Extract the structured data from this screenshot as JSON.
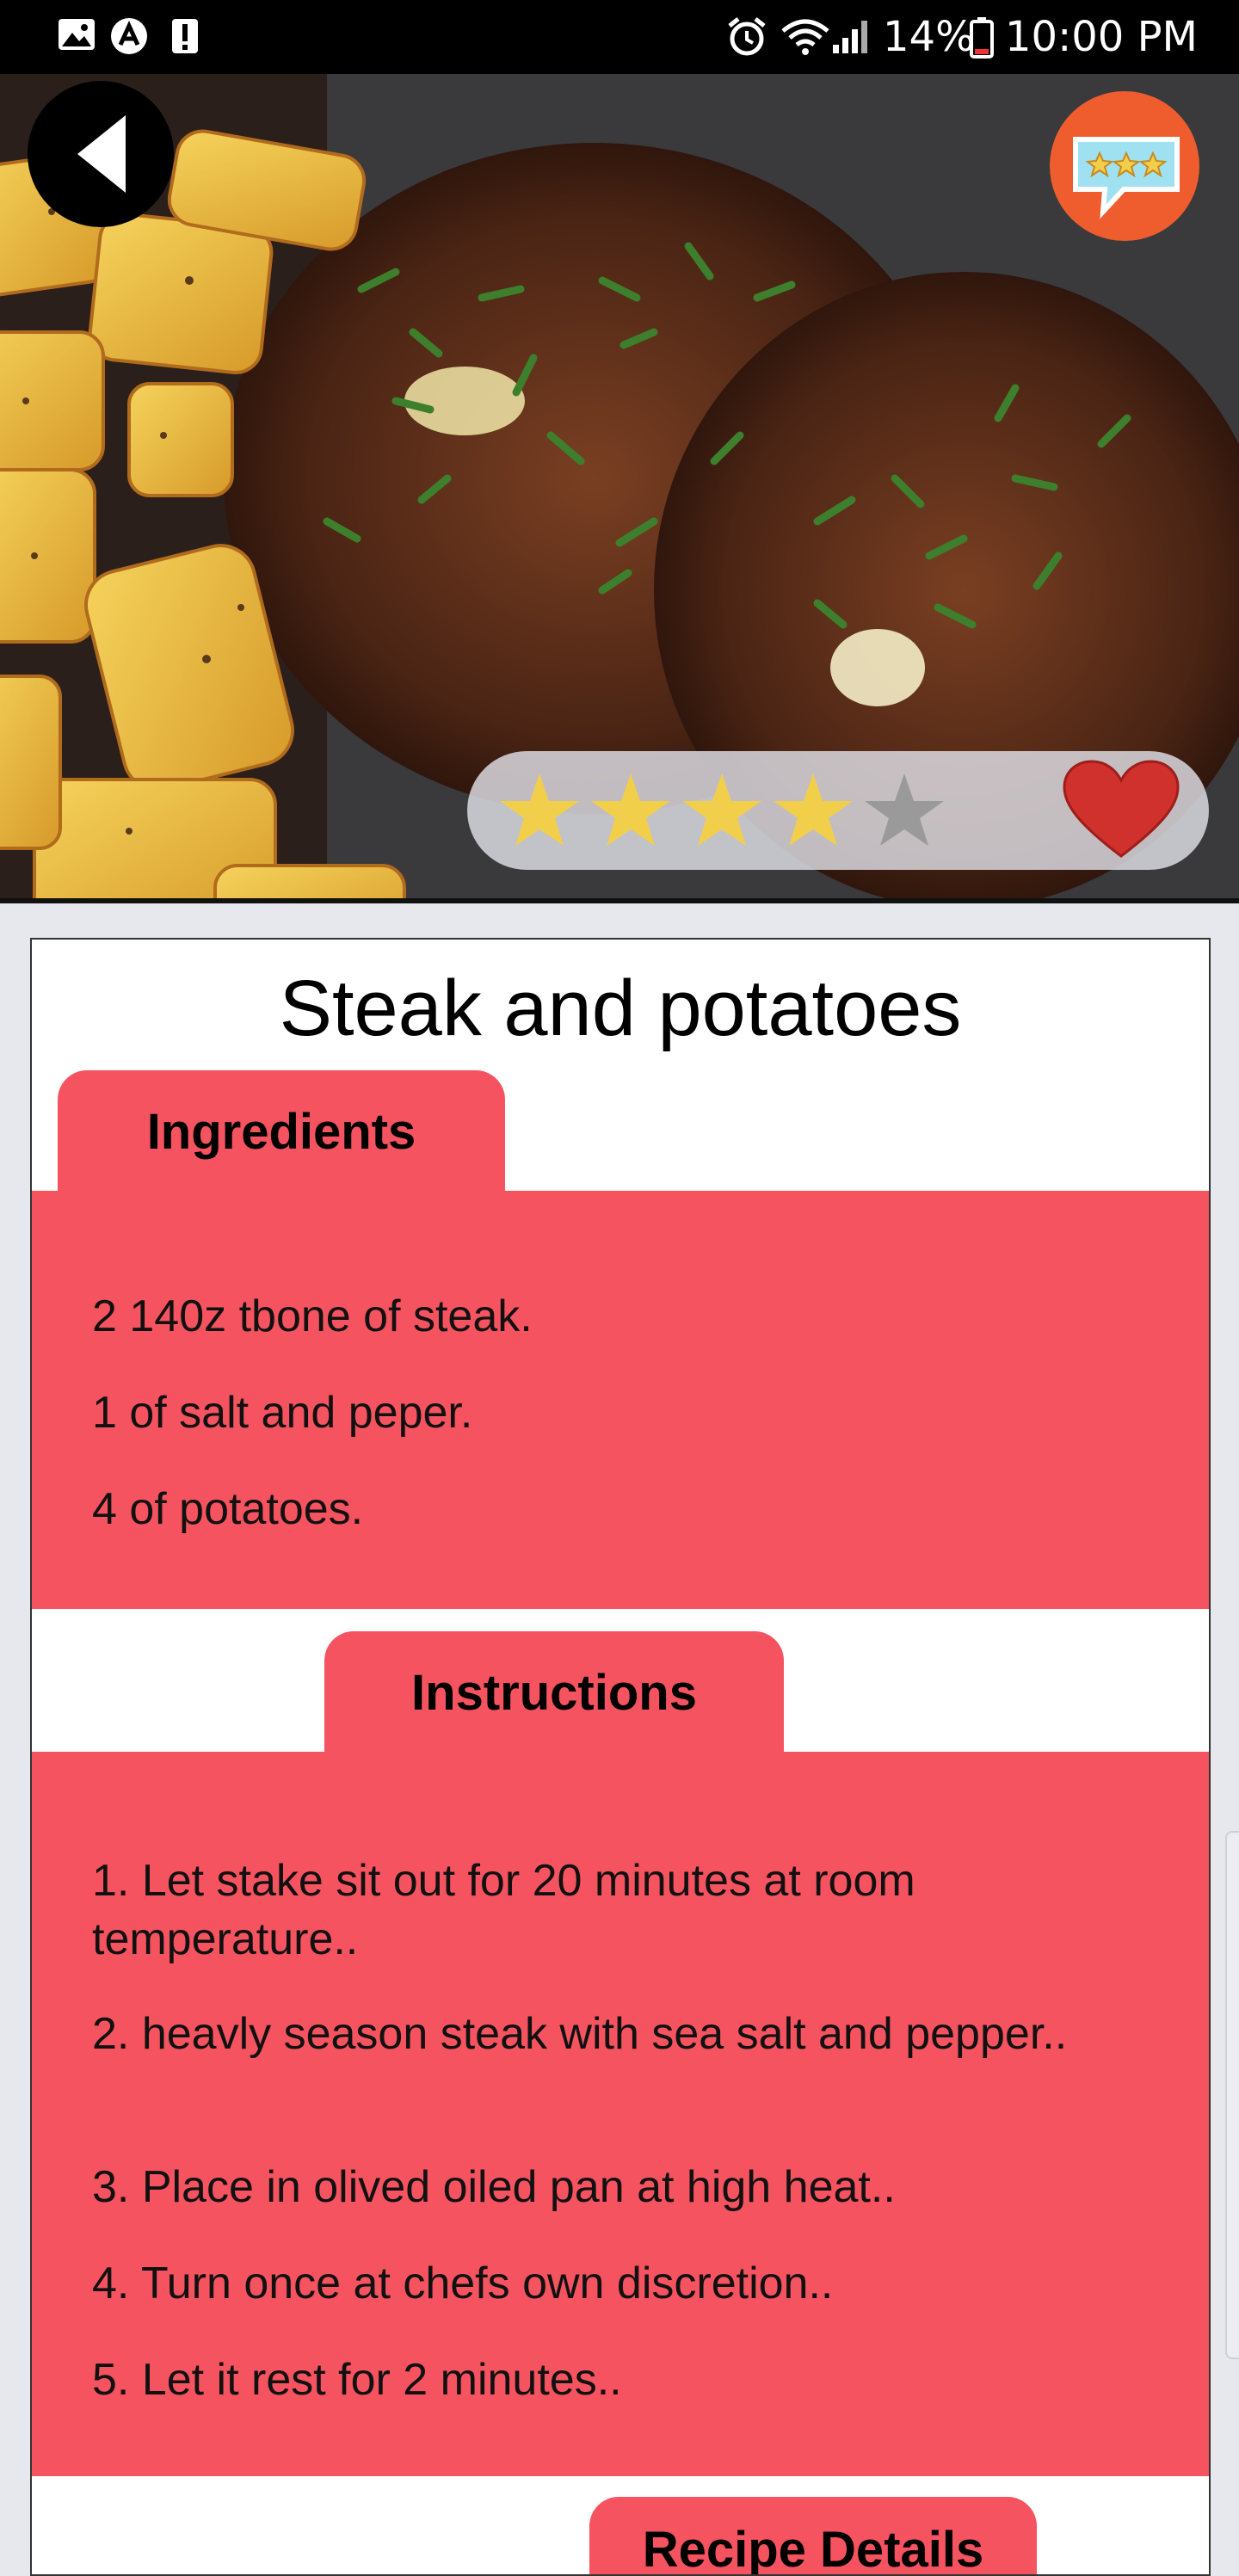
{
  "status_bar": {
    "left_icons": [
      "image-icon",
      "app-a-icon",
      "alert-icon"
    ],
    "right_icons": [
      "alarm-icon",
      "wifi-icon",
      "signal-icon",
      "battery-icon"
    ],
    "battery": "14%",
    "time": "10:00 PM"
  },
  "hero": {
    "image_subject": "steak-and-potatoes-photo",
    "back_icon": "back-arrow-icon",
    "review_icon": "review-stars-icon",
    "rating": 4,
    "rating_max": 5,
    "favorite_icon": "heart-icon",
    "favorite_color": "#d0312d"
  },
  "recipe": {
    "title": "Steak and potatoes",
    "ingredients_tab": "Ingredients",
    "ingredients": [
      "2 140z tbone of steak.",
      "1 of salt and peper.",
      "4 of potatoes."
    ],
    "instructions_tab": "Instructions",
    "instructions": [
      "1. Let stake sit out for 20 minutes at room temperature..",
      "2. heavly season steak with sea salt and pepper..",
      "3. Place in olived oiled pan at high heat..",
      "4. Turn once at chefs own discretion..",
      "5. Let it rest for 2 minutes.."
    ],
    "details_tab": "Recipe Details"
  },
  "colors": {
    "accent": "#f5535f",
    "star_filled": "#f2cf4a",
    "star_empty": "#9a9a9a",
    "review_button": "#ef5d2e"
  }
}
